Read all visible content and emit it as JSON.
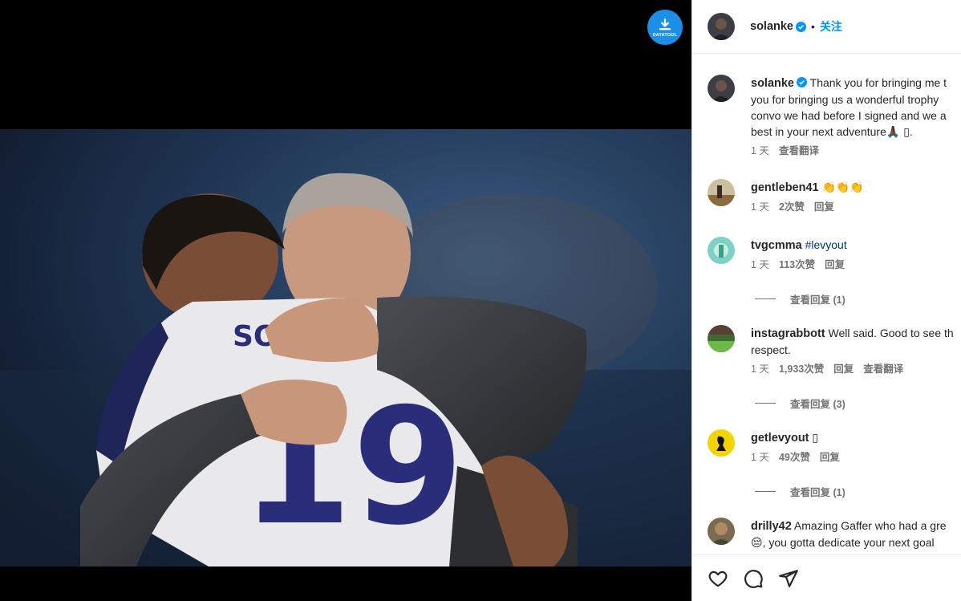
{
  "post_author": {
    "username": "solanke",
    "separator": "•",
    "follow_label": "关注"
  },
  "download_button": {
    "label": "DATATOOL"
  },
  "caption": {
    "username": "solanke",
    "line1": "Thank you for bringing me t",
    "line2": "you for bringing us a wonderful trophy",
    "line3": "convo we had before I signed and we a",
    "line4": "best in your next adventure🙏🏿 ▯.",
    "time": "1 天",
    "translate": "查看翻译"
  },
  "comments": [
    {
      "username": "gentleben41",
      "text": "👏👏👏",
      "time": "1 天",
      "likes": "2次赞",
      "reply": "回复"
    },
    {
      "username": "tvgcmma",
      "text": "#levyout",
      "time": "1 天",
      "likes": "113次赞",
      "reply": "回复",
      "view_replies": "查看回复 (1)"
    },
    {
      "username": "instagrabbott",
      "text": "Well said. Good to see th",
      "text2": "respect.",
      "time": "1 天",
      "likes": "1,933次赞",
      "reply": "回复",
      "translate": "查看翻译",
      "view_replies": "查看回复 (3)"
    },
    {
      "username": "getlevyout",
      "text": "▯",
      "time": "1 天",
      "likes": "49次赞",
      "reply": "回复",
      "view_replies": "查看回复 (1)"
    },
    {
      "username": "drilly42",
      "text": "Amazing Gaffer who had a gre",
      "text2": "😔, you gotta dedicate your next goal"
    }
  ],
  "icons": [
    "heart-icon",
    "comment-icon",
    "share-icon",
    "verified-badge-icon",
    "download-icon"
  ],
  "colors": {
    "accent": "#0095f6",
    "verified": "#0095f6",
    "background_media": "#000000"
  }
}
